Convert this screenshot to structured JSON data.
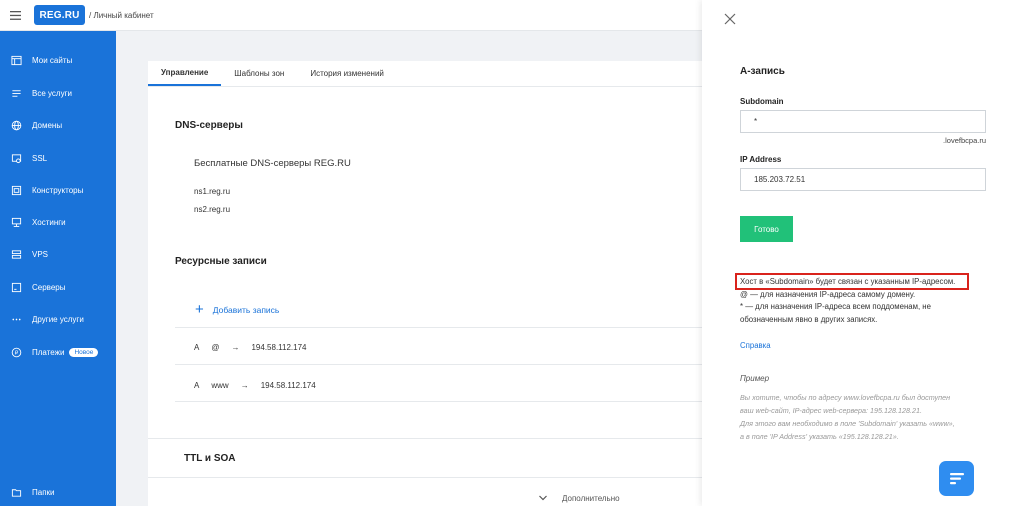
{
  "header": {
    "logo_text": "REG.RU",
    "breadcrumb": "/ Личный кабинет"
  },
  "sidebar": {
    "items": [
      {
        "label": "Мои сайты",
        "icon": "sites-icon"
      },
      {
        "label": "Все услуги",
        "icon": "list-icon"
      },
      {
        "label": "Домены",
        "icon": "globe-icon"
      },
      {
        "label": "SSL",
        "icon": "ssl-icon"
      },
      {
        "label": "Конструкторы",
        "icon": "builder-icon"
      },
      {
        "label": "Хостинги",
        "icon": "hosting-icon"
      },
      {
        "label": "VPS",
        "icon": "vps-icon"
      },
      {
        "label": "Серверы",
        "icon": "server-icon"
      },
      {
        "label": "Другие услуги",
        "icon": "dots-icon"
      },
      {
        "label": "Платежи",
        "icon": "payment-icon",
        "badge": "Новое"
      }
    ],
    "bottom_item": {
      "label": "Папки",
      "icon": "folder-icon"
    }
  },
  "main": {
    "tabs": [
      {
        "label": "Управление",
        "active": true
      },
      {
        "label": "Шаблоны зон",
        "active": false
      },
      {
        "label": "История изменений",
        "active": false
      }
    ],
    "dns_title": "DNS-серверы",
    "dns_subtitle": "Бесплатные DNS-серверы REG.RU",
    "ns1": "ns1.reg.ru",
    "ns2": "ns2.reg.ru",
    "records_title": "Ресурсные записи",
    "add_record": "Добавить запись",
    "records": [
      {
        "type": "A",
        "host": "@",
        "arrow": "→",
        "value": "194.58.112.174"
      },
      {
        "type": "A",
        "host": "www",
        "arrow": "→",
        "value": "194.58.112.174"
      }
    ],
    "ttl_title": "TTL и SOA",
    "more_label": "Дополнительно"
  },
  "panel": {
    "title": "А-запись",
    "subdomain_label": "Subdomain",
    "subdomain_value": "*",
    "domain_suffix": ".lovefbcpa.ru",
    "ip_label": "IP Address",
    "ip_value": "185.203.72.51",
    "submit_label": "Готово",
    "help_line1": "Хост в «Subdomain» будет связан с указанным IP-адресом.",
    "help_line2": "@ — для назначения IP-адреса самому домену.",
    "help_line3": "* — для назначения IP-адреса всем поддоменам, не",
    "help_line4": "обозначенным явно в других записях.",
    "help_link": "Справка",
    "example_title": "Пример",
    "example_line1": "Вы хотите, чтобы по адресу www.lovefbcpa.ru был доступен",
    "example_line2": "ваш web-сайт, IP-адрес web-сервера: 195.128.128.21.",
    "example_line3": "Для этого вам необходимо в поле 'Subdomain' указать «www»,",
    "example_line4": "а в поле 'IP Address' указать «195.128.128.21»."
  },
  "colors": {
    "brand": "#1a73d9",
    "success": "#21c179",
    "highlight": "#d9231c"
  }
}
